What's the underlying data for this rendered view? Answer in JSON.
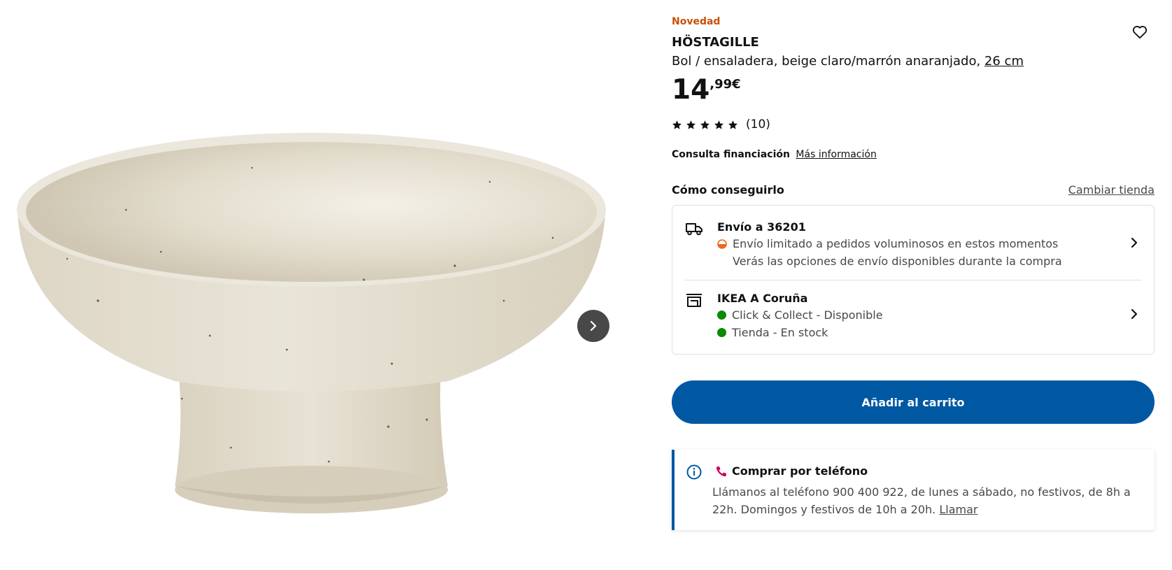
{
  "product": {
    "badge": "Novedad",
    "name": "HÖSTAGILLE",
    "description": "Bol / ensaladera, beige claro/marrón anaranjado, ",
    "size": "26 cm",
    "price_int": "14",
    "price_dec": ",99€",
    "rating_value": 5,
    "rating_count": "(10)",
    "image_icon": "bowl-image",
    "colors": {
      "badge": "#ca5008",
      "accent": "#0058a3",
      "green": "#0a8a00"
    }
  },
  "financing": {
    "label": "Consulta financiación",
    "link": "Más información"
  },
  "availability": {
    "title": "Cómo conseguirlo",
    "change_store": "Cambiar tienda",
    "delivery": {
      "icon": "truck-icon",
      "title": "Envío a 36201",
      "status": "Envío limitado a pedidos voluminosos en estos momentos",
      "note": "Verás las opciones de envío disponibles durante la compra"
    },
    "store": {
      "icon": "store-icon",
      "title": "IKEA A Coruña",
      "click_collect": "Click & Collect - Disponible",
      "in_store": "Tienda - En stock"
    }
  },
  "cart": {
    "label": "Añadir al carrito"
  },
  "phone": {
    "title": "Comprar por teléfono",
    "text": "Llámanos al teléfono 900 400 922, de lunes a sábado, no festivos, de 8h a 22h. Domingos y festivos de 10h a 20h. ",
    "call_link": "Llamar"
  }
}
